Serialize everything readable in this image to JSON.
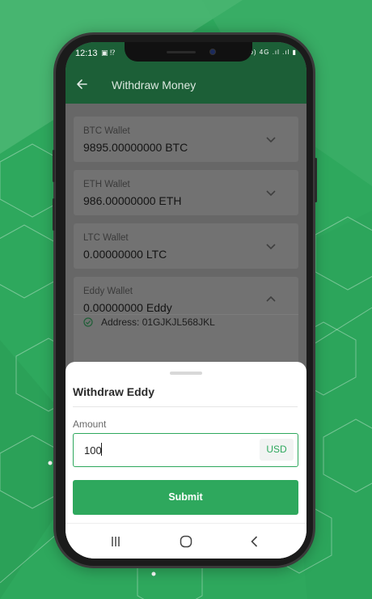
{
  "status_bar": {
    "time": "12:13",
    "left_icons": "▣ ⁉",
    "right_icons": "Vo) 4G .ıl .ıl ▮"
  },
  "app_bar": {
    "title": "Withdraw Money",
    "back_icon": "arrow-left-icon"
  },
  "wallets": [
    {
      "label": "BTC Wallet",
      "value": "9895.00000000 BTC",
      "expanded": false
    },
    {
      "label": "ETH Wallet",
      "value": "986.00000000 ETH",
      "expanded": false
    },
    {
      "label": "LTC Wallet",
      "value": "0.00000000 LTC",
      "expanded": false
    },
    {
      "label": "Eddy Wallet",
      "value": "0.00000000 Eddy",
      "expanded": true,
      "address": "Address: 01GJKJL568JKL"
    }
  ],
  "sheet": {
    "title": "Withdraw Eddy",
    "amount_label": "Amount",
    "amount_value": "100",
    "amount_unit": "USD",
    "submit_label": "Submit"
  },
  "colors": {
    "accent": "#2ea85d",
    "app_bar": "#1c5f37",
    "background": "#2ea85d"
  },
  "nav_icons": [
    "recents-icon",
    "home-icon",
    "back-icon"
  ]
}
